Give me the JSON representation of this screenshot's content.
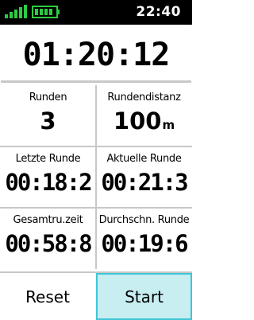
{
  "status": {
    "time": "22:40",
    "signal_icon": "signal-bars-icon",
    "battery_icon": "battery-icon",
    "accent_color": "#3ec6d6",
    "signal_color": "#2ecc40"
  },
  "timer": {
    "value": "01:20:12"
  },
  "fields": [
    {
      "label": "Runden",
      "value": "3"
    },
    {
      "label": "Rundendistanz",
      "value": "100",
      "unit": "m"
    },
    {
      "label": "Letzte Runde",
      "value": "00:18:2"
    },
    {
      "label": "Aktuelle Runde",
      "value": "00:21:3"
    },
    {
      "label": "Gesamtru.zeit",
      "value": "00:58:8"
    },
    {
      "label": "Durchschn. Runde",
      "value": "00:19:6"
    }
  ],
  "buttons": {
    "reset_label": "Reset",
    "start_label": "Start"
  }
}
